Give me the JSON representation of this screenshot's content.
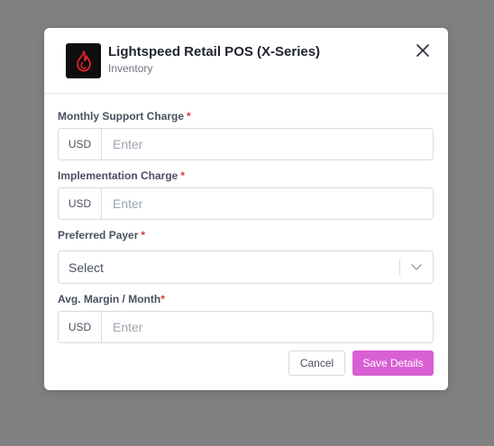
{
  "dialog": {
    "title": "Lightspeed Retail POS (X-Series)",
    "subtitle": "Inventory",
    "logo_icon": "lightspeed-flame-logo",
    "close_icon": "close-icon"
  },
  "fields": {
    "monthly_support": {
      "label": "Monthly Support Charge",
      "required_mark": "*",
      "prefix": "USD",
      "placeholder": "Enter",
      "value": ""
    },
    "implementation": {
      "label": "Implementation Charge",
      "required_mark": "*",
      "prefix": "USD",
      "placeholder": "Enter",
      "value": ""
    },
    "preferred_payer": {
      "label": "Preferred Payer",
      "required_mark": "*",
      "selected": "Select",
      "chevron_icon": "chevron-down-icon"
    },
    "avg_margin": {
      "label": "Avg. Margin / Month",
      "required_mark": "*",
      "prefix": "USD",
      "placeholder": "Enter",
      "value": ""
    }
  },
  "actions": {
    "cancel_label": "Cancel",
    "save_label": "Save Details"
  },
  "colors": {
    "overlay": "#808080",
    "primary_button": "#d95fd4",
    "required_mark": "#e0383e",
    "logo_flame": "#e0202b"
  }
}
